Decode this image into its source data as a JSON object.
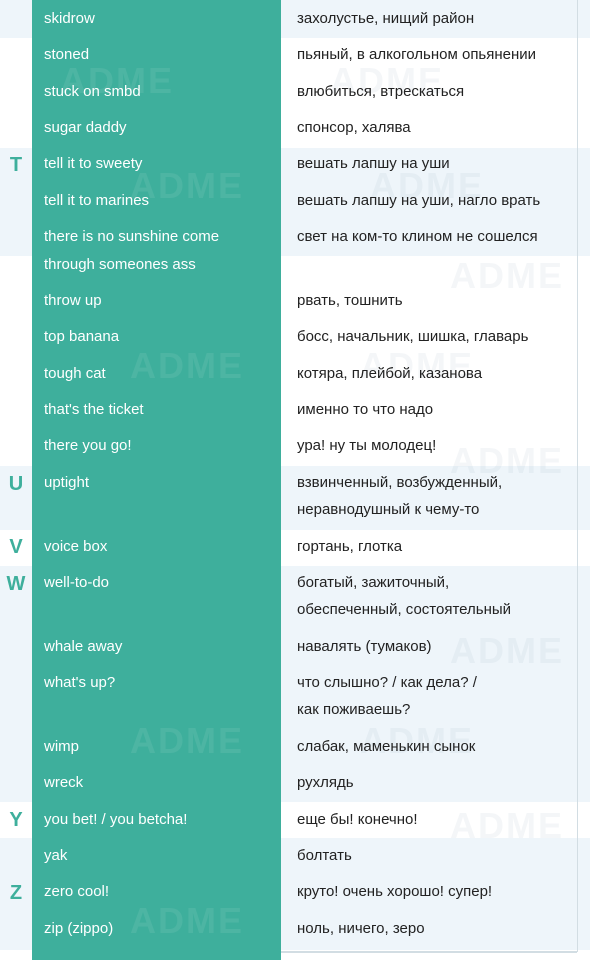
{
  "watermark": "ADME",
  "colors": {
    "accent": "#3eaf9c",
    "band": "#eef5fa",
    "text": "#222222"
  },
  "letters": [
    "T",
    "U",
    "V",
    "W",
    "Y",
    "Z"
  ],
  "entries": [
    {
      "en": "skidrow",
      "ru": [
        "захолустье, нищий район"
      ]
    },
    {
      "en": "stoned",
      "ru": [
        "пьяный, в алкогольном опьянении"
      ]
    },
    {
      "en": "stuck on smbd",
      "ru": [
        "влюбиться, втрескаться"
      ]
    },
    {
      "en": "sugar daddy",
      "ru": [
        "спонсор, халява"
      ]
    },
    {
      "en": "tell it to sweety",
      "ru": [
        "вешать лапшу на уши"
      ]
    },
    {
      "en": "tell it to marines",
      "ru": [
        "вешать лапшу на уши, нагло врать"
      ]
    },
    {
      "en": "there is no sunshine come",
      "en2": "through someones ass",
      "ru": [
        "свет на ком-то клином не сошелся"
      ]
    },
    {
      "en": "throw up",
      "ru": [
        "рвать, тошнить"
      ]
    },
    {
      "en": "top banana",
      "ru": [
        "босс, начальник, шишка, главарь"
      ]
    },
    {
      "en": "tough cat",
      "ru": [
        "котяра, плейбой, казанова"
      ]
    },
    {
      "en": "that's the ticket",
      "ru": [
        "именно то что надо"
      ]
    },
    {
      "en": "there you go!",
      "ru": [
        "ура! ну ты молодец!"
      ]
    },
    {
      "en": "uptight",
      "ru": [
        "взвинченный, возбужденный,",
        "неравнодушный к чему-то"
      ]
    },
    {
      "en": "voice box",
      "ru": [
        "гортань, глотка"
      ]
    },
    {
      "en": "well-to-do",
      "ru": [
        "богатый, зажиточный,",
        "обеспеченный, состоятельный"
      ]
    },
    {
      "en": "whale away",
      "ru": [
        "навалять (тумаков)"
      ]
    },
    {
      "en": "what's up?",
      "ru": [
        "что слышно? / как дела? /",
        "как поживаешь?"
      ]
    },
    {
      "en": "wimp",
      "ru": [
        "слабак, маменькин сынок"
      ]
    },
    {
      "en": "wreck",
      "ru": [
        "рухлядь"
      ]
    },
    {
      "en": "you bet! / you betcha!",
      "ru": [
        "еще бы! конечно!"
      ]
    },
    {
      "en": "yak",
      "ru": [
        "болтать"
      ]
    },
    {
      "en": "zero cool!",
      "ru": [
        "круто! очень хорошо! супер!"
      ]
    },
    {
      "en": "zip (zippo)",
      "ru": [
        "ноль, ничего, зеро"
      ]
    }
  ]
}
